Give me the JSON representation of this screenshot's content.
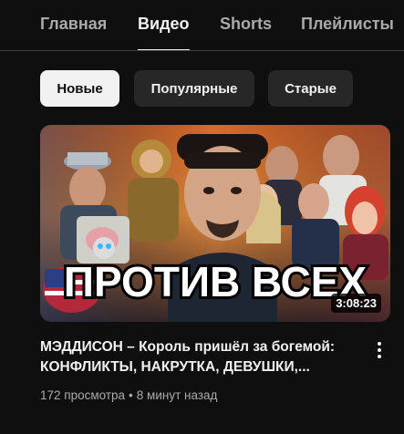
{
  "tabs": [
    {
      "label": "Главная",
      "active": false
    },
    {
      "label": "Видео",
      "active": true
    },
    {
      "label": "Shorts",
      "active": false
    },
    {
      "label": "Плейлисты",
      "active": false
    }
  ],
  "filters": {
    "newest": "Новые",
    "popular": "Популярные",
    "oldest": "Старые",
    "selected": "Новые"
  },
  "video": {
    "thumbnail_text": "ПРОТИВ ВСЕХ",
    "duration": "3:08:23",
    "title_line1": "МЭДДИСОН – Король пришёл за богемой:",
    "title_line2": "КОНФЛИКТЫ, НАКРУТКА, ДЕВУШКИ,...",
    "views": "172 просмотра",
    "separator": "•",
    "time": "8 минут назад"
  },
  "colors": {
    "background": "#0f0f0f",
    "chip_background": "#272727",
    "chip_active_background": "#f1f1f1",
    "text_primary": "#f1f1f1",
    "text_secondary": "#aaaaaa",
    "divider": "#3f3f3f"
  },
  "icons": {
    "more": "more-vertical-icon"
  }
}
